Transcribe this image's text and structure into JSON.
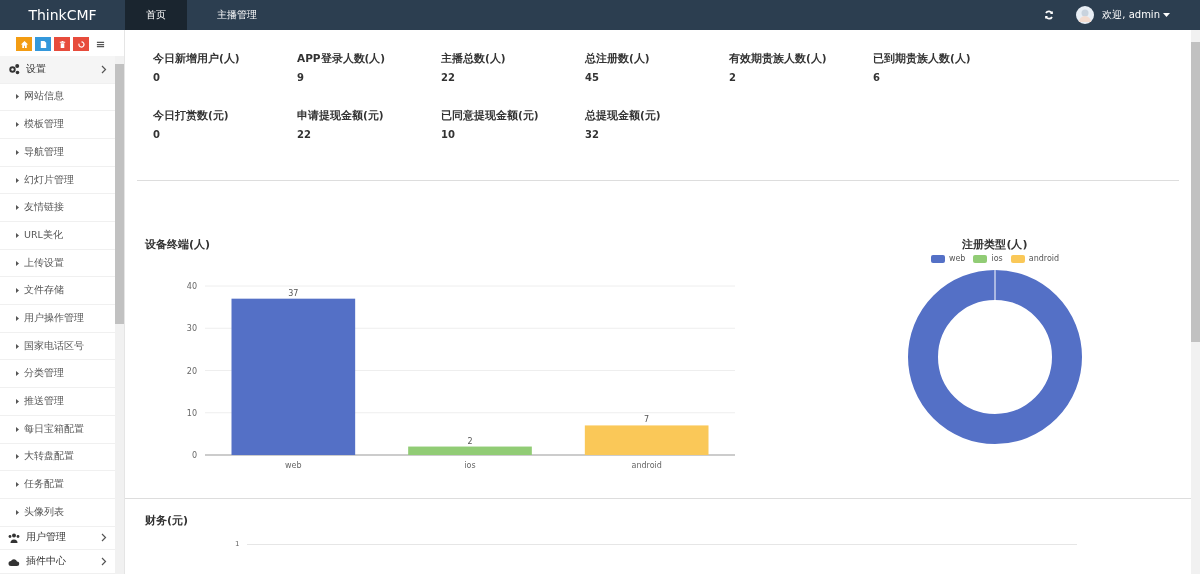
{
  "brand": "ThinkCMF",
  "nav_tabs": [
    {
      "label": "首页",
      "selected": true
    },
    {
      "label": "主播管理",
      "selected": false
    }
  ],
  "user": {
    "greeting": "欢迎, admin"
  },
  "toolbar_buttons": [
    {
      "kind": "home",
      "color": "#f39c12"
    },
    {
      "kind": "file",
      "color": "#3498db"
    },
    {
      "kind": "trash",
      "color": "#e74c3c"
    },
    {
      "kind": "recycle",
      "color": "#e74c3c"
    },
    {
      "kind": "list",
      "color": "#ffffff"
    }
  ],
  "sidebar": {
    "items": [
      {
        "label": "设置",
        "kind": "gears",
        "expanded": true,
        "children": [
          {
            "label": "网站信息"
          },
          {
            "label": "模板管理"
          },
          {
            "label": "导航管理"
          },
          {
            "label": "幻灯片管理"
          },
          {
            "label": "友情链接"
          },
          {
            "label": "URL美化"
          },
          {
            "label": "上传设置"
          },
          {
            "label": "文件存储"
          },
          {
            "label": "用户操作管理"
          },
          {
            "label": "国家电话区号"
          },
          {
            "label": "分类管理"
          },
          {
            "label": "推送管理"
          },
          {
            "label": "每日宝箱配置"
          },
          {
            "label": "大转盘配置"
          },
          {
            "label": "任务配置"
          },
          {
            "label": "头像列表"
          }
        ]
      },
      {
        "label": "用户管理",
        "kind": "users",
        "expanded": false
      },
      {
        "label": "插件中心",
        "kind": "cloud",
        "expanded": false
      }
    ]
  },
  "stats": [
    [
      {
        "label": "今日新增用户(人)",
        "value": "0"
      },
      {
        "label": "APP登录人数(人)",
        "value": "9"
      },
      {
        "label": "主播总数(人)",
        "value": "22"
      },
      {
        "label": "总注册数(人)",
        "value": "45"
      },
      {
        "label": "有效期贵族人数(人)",
        "value": "2"
      },
      {
        "label": "已到期贵族人数(人)",
        "value": "6"
      }
    ],
    [
      {
        "label": "今日打赏数(元)",
        "value": "0"
      },
      {
        "label": "申请提现金额(元)",
        "value": "22"
      },
      {
        "label": "已同意提现金额(元)",
        "value": "10"
      },
      {
        "label": "总提现金额(元)",
        "value": "32"
      }
    ]
  ],
  "device_chart": {
    "title": "设备终端(人)",
    "chart_data": {
      "type": "bar",
      "categories": [
        "web",
        "ios",
        "android"
      ],
      "grid": true,
      "series": [
        {
          "colors": [
            "#5470c6",
            "#91cc75",
            "#fac858"
          ],
          "values": [
            37,
            2,
            7
          ]
        }
      ],
      "ylim": [
        0,
        40
      ],
      "yticks": [
        0,
        10,
        20,
        30,
        40
      ],
      "data_labels": true
    }
  },
  "register_chart": {
    "title": "注册类型(人)",
    "legend": [
      {
        "label": "web",
        "color": "#5470c6"
      },
      {
        "label": "ios",
        "color": "#91cc75"
      },
      {
        "label": "android",
        "color": "#fac858"
      }
    ]
  },
  "finance_chart": {
    "title": "财务(元)",
    "tick": "1"
  }
}
